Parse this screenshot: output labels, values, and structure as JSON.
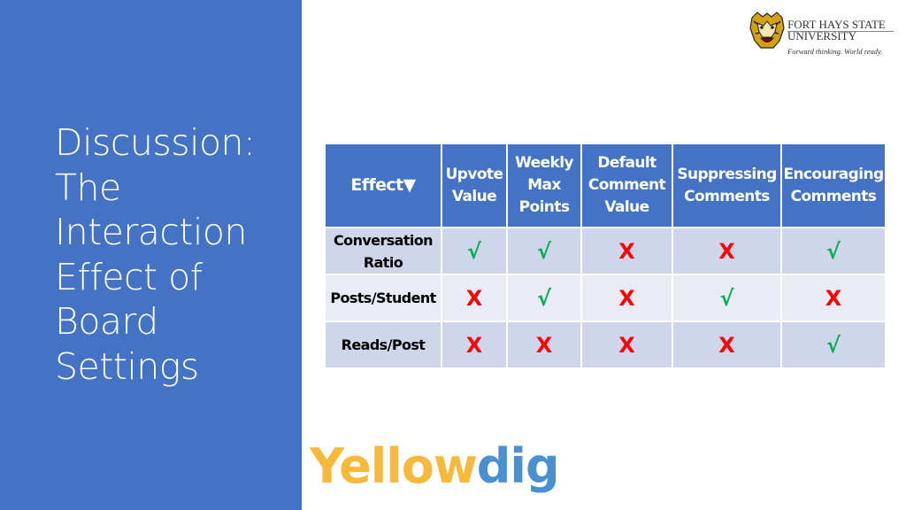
{
  "slide": {
    "title_lines": [
      "Discussion:",
      "The",
      "Interaction",
      "Effect of",
      "Board",
      "Settings"
    ]
  },
  "fhsu_logo": {
    "name_line1": "FORT HAYS STATE",
    "name_line2": "UNIVERSITY",
    "tagline": "Forward thinking. World ready.",
    "icon": "tiger-mascot-icon"
  },
  "table": {
    "corner_header": "Effect",
    "corner_icon": "▼",
    "columns": [
      [
        "Upvote",
        "Value"
      ],
      [
        "Weekly",
        "Max",
        "Points"
      ],
      [
        "Default",
        "Comment",
        "Value"
      ],
      [
        "Suppressing",
        "Comments"
      ],
      [
        "Encouraging",
        "Comments"
      ]
    ],
    "rows": [
      {
        "label": [
          "Conversation",
          "Ratio"
        ],
        "values": [
          "√",
          "√",
          "X",
          "X",
          "√"
        ]
      },
      {
        "label": [
          "Posts/Student"
        ],
        "values": [
          "X",
          "√",
          "X",
          "√",
          "X"
        ]
      },
      {
        "label": [
          "Reads/Post"
        ],
        "values": [
          "X",
          "X",
          "X",
          "X",
          "√"
        ]
      }
    ],
    "colors": {
      "yes": "#00b050",
      "no": "#ff0000",
      "header": "#4472c4"
    }
  },
  "yellowdig_logo": {
    "part1": "Yellow",
    "part2": "dig"
  }
}
